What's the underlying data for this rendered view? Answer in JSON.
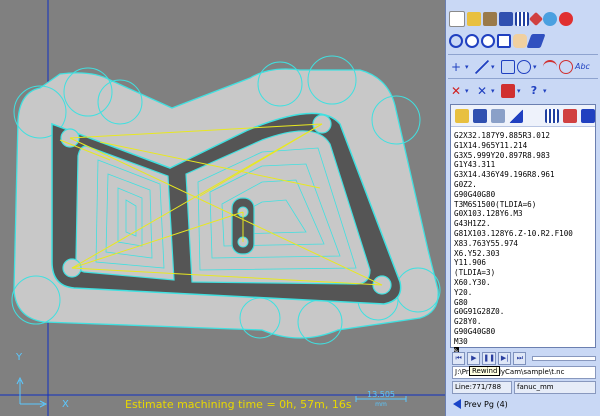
{
  "status": {
    "estimate_text": "Estimate machining time = 0h, 57m, 16s",
    "scale_value": "13.505",
    "scale_unit": "mm"
  },
  "axes": {
    "y_label": "Y",
    "x_label": "X"
  },
  "toolbar_icons": {
    "row1": [
      "new-file-icon",
      "open-file-icon",
      "tools-icon",
      "save-icon",
      "grid-icon",
      "measure-icon",
      "target-icon",
      "close-red-icon"
    ],
    "row2": [
      "pan-center-icon",
      "zoom-in-icon",
      "zoom-out-icon",
      "zoom-fit-icon",
      "hand-pan-icon",
      "highlighter-icon"
    ],
    "row3": [
      "point-icon",
      "line-icon",
      "rectangle-icon",
      "circle-icon",
      "arc-icon",
      "text-icon"
    ],
    "row4": [
      "delete-icon",
      "trim-icon",
      "offset-icon",
      "help-icon"
    ]
  },
  "editor": {
    "lines": [
      "G2X32.187Y9.885R3.012",
      "G1X14.965Y11.214",
      "G3X5.999Y20.897R8.983",
      "G1Y43.311",
      "G3X14.436Y49.196R8.961",
      "G0Z2.",
      "G90G40G80",
      "T3M6S1500(TLDIA=6)",
      "G0X103.128Y6.M3",
      "G43H1Z2.",
      "G81X103.128Y6.Z-10.R2.F100",
      "X83.763Y55.974",
      "X6.Y52.303",
      "Y11.906",
      "(TLDIA=3)",
      "X60.Y30.",
      "Y20.",
      "G80",
      "G0G91G28Z0.",
      "G28Y0.",
      "G90G40G80",
      "M30"
    ],
    "cursor_char": "%"
  },
  "transport": {
    "tooltip": "Rewind"
  },
  "file": {
    "path": "J:\\Pr          es\\SimplyCam\\sample\\t.nc",
    "line_status": "Line:771/788",
    "controller": "fanuc_mm",
    "prev_page": "Prev Pg (4)"
  },
  "colors": {
    "canvas_bg": "#808080",
    "part_outline": "#40e0e0",
    "toolpath": "#e8e820",
    "panel_bg": "#c9d8f5"
  }
}
